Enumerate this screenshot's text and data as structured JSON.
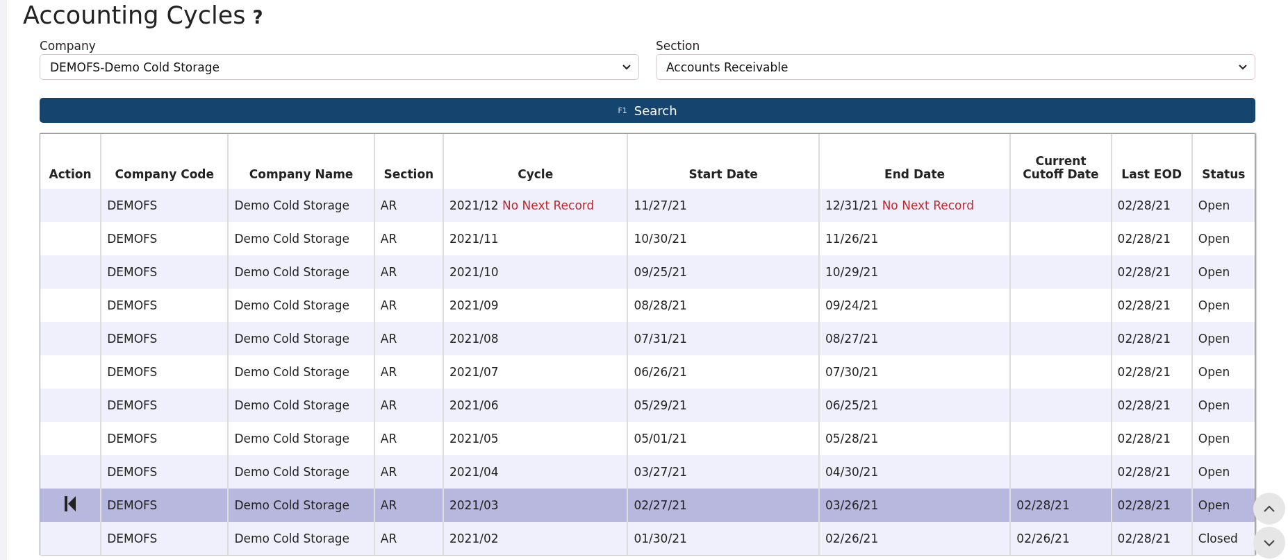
{
  "page": {
    "title": "Accounting Cycles",
    "help": "?"
  },
  "filters": [
    {
      "label": "Company",
      "value": "DEMOFS-Demo Cold Storage"
    },
    {
      "label": "Section",
      "value": "Accounts Receivable"
    }
  ],
  "search_button": {
    "key": "F1",
    "label": "Search"
  },
  "table": {
    "columns": [
      "Action",
      "Company Code",
      "Company Name",
      "Section",
      "Cycle",
      "Start Date",
      "End Date",
      "Current Cutoff Date",
      "Last EOD",
      "Status"
    ],
    "rows": [
      {
        "selected": false,
        "company_code": "DEMOFS",
        "company_name": "Demo Cold Storage",
        "section": "AR",
        "cycle": "2021/12",
        "cycle_note": "No Next Record",
        "start_date": "11/27/21",
        "end_date": "12/31/21",
        "end_note": "No Next Record",
        "cutoff_date": "",
        "last_eod": "02/28/21",
        "status": "Open"
      },
      {
        "selected": false,
        "company_code": "DEMOFS",
        "company_name": "Demo Cold Storage",
        "section": "AR",
        "cycle": "2021/11",
        "start_date": "10/30/21",
        "end_date": "11/26/21",
        "last_eod": "02/28/21",
        "status": "Open"
      },
      {
        "selected": false,
        "company_code": "DEMOFS",
        "company_name": "Demo Cold Storage",
        "section": "AR",
        "cycle": "2021/10",
        "start_date": "09/25/21",
        "end_date": "10/29/21",
        "last_eod": "02/28/21",
        "status": "Open"
      },
      {
        "selected": false,
        "company_code": "DEMOFS",
        "company_name": "Demo Cold Storage",
        "section": "AR",
        "cycle": "2021/09",
        "start_date": "08/28/21",
        "end_date": "09/24/21",
        "last_eod": "02/28/21",
        "status": "Open"
      },
      {
        "selected": false,
        "company_code": "DEMOFS",
        "company_name": "Demo Cold Storage",
        "section": "AR",
        "cycle": "2021/08",
        "start_date": "07/31/21",
        "end_date": "08/27/21",
        "last_eod": "02/28/21",
        "status": "Open"
      },
      {
        "selected": false,
        "company_code": "DEMOFS",
        "company_name": "Demo Cold Storage",
        "section": "AR",
        "cycle": "2021/07",
        "start_date": "06/26/21",
        "end_date": "07/30/21",
        "last_eod": "02/28/21",
        "status": "Open"
      },
      {
        "selected": false,
        "company_code": "DEMOFS",
        "company_name": "Demo Cold Storage",
        "section": "AR",
        "cycle": "2021/06",
        "start_date": "05/29/21",
        "end_date": "06/25/21",
        "last_eod": "02/28/21",
        "status": "Open"
      },
      {
        "selected": false,
        "company_code": "DEMOFS",
        "company_name": "Demo Cold Storage",
        "section": "AR",
        "cycle": "2021/05",
        "start_date": "05/01/21",
        "end_date": "05/28/21",
        "last_eod": "02/28/21",
        "status": "Open"
      },
      {
        "selected": false,
        "company_code": "DEMOFS",
        "company_name": "Demo Cold Storage",
        "section": "AR",
        "cycle": "2021/04",
        "start_date": "03/27/21",
        "end_date": "04/30/21",
        "last_eod": "02/28/21",
        "status": "Open"
      },
      {
        "selected": true,
        "company_code": "DEMOFS",
        "company_name": "Demo Cold Storage",
        "section": "AR",
        "cycle": "2021/03",
        "start_date": "02/27/21",
        "end_date": "03/26/21",
        "cutoff_date": "02/28/21",
        "last_eod": "02/28/21",
        "status": "Open"
      },
      {
        "selected": false,
        "company_code": "DEMOFS",
        "company_name": "Demo Cold Storage",
        "section": "AR",
        "cycle": "2021/02",
        "start_date": "01/30/21",
        "end_date": "02/26/21",
        "cutoff_date": "02/26/21",
        "last_eod": "02/28/21",
        "status": "Closed"
      }
    ]
  }
}
